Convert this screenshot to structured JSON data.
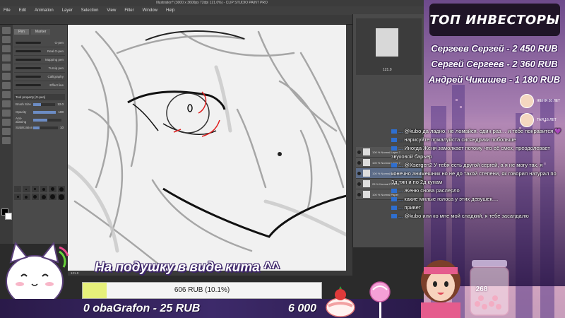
{
  "app": {
    "title": "Illustration* (3000 x 3600px 72dpi 121.0%) - CLIP STUDIO PAINT PRO",
    "menu": [
      "File",
      "Edit",
      "Animation",
      "Layer",
      "Selection",
      "View",
      "Filter",
      "Window",
      "Help"
    ],
    "subtool_tabs": [
      "Pen",
      "Marker"
    ],
    "brushes": [
      "G-pen",
      "Real G-pen",
      "Mapping pen",
      "Turnip pen",
      "Calligraphy",
      "Effect line"
    ],
    "tool_property": {
      "header": "Tool property [G-pen]",
      "rows": [
        {
          "label": "Brush Size",
          "value": "12.0"
        },
        {
          "label": "Opacity",
          "value": "100"
        },
        {
          "label": "Anti-aliasing",
          "value": ""
        },
        {
          "label": "Stabilization",
          "value": "10"
        }
      ],
      "levels": [
        0.35,
        1.0,
        0.5,
        0.25
      ]
    },
    "navigator_zoom": "121.0",
    "canvas_status": "121.0",
    "layers": [
      {
        "name": "100 % Normal Layer 7",
        "selected": false
      },
      {
        "name": "100 % Normal Layer 7",
        "selected": false
      },
      {
        "name": "100 % Normal Layer 6",
        "selected": true
      },
      {
        "name": "25 % Normal Folder 1",
        "selected": false
      },
      {
        "name": "100 % Normal Paper",
        "selected": false
      }
    ]
  },
  "overlay": {
    "top_title": "ТОП ИНВЕСТОРЫ",
    "investors": [
      "Сергеев Сергей - 2 450 RUB",
      "Сергей Сергеев - 2 360 RUB",
      "Андрей Чикишев - 1 180 RUB"
    ],
    "viewers": [
      {
        "name": "ЖЕНЯ 20 ЛЕТ"
      },
      {
        "name": "ТАЯ 16 ЛЕТ"
      }
    ],
    "chat": [
      {
        "user": "...",
        "text": "@kubo да ладно, не ломайся. один раз… и тебе понравится 💜"
      },
      {
        "user": "...",
        "text": "нарисуйте пожалуйста сисяндрики побольше"
      },
      {
        "user": "...",
        "text": "Иногда Женя замолкает потому что её смех, преодолевает звуковой барьер"
      },
      {
        "user": "...",
        "text": "@Xsergen2 У тебя есть другой сергей, а я не могу так, я конечно анимешник но не до такой степени, як говорил натурал по 3д тян и по 2д кунам"
      },
      {
        "user": "...",
        "text": "Женю снова раслерло"
      },
      {
        "user": "...",
        "text": "какие милые голоса у этих девушек...."
      },
      {
        "user": "...",
        "text": "привет"
      },
      {
        "user": "...",
        "text": "@kubo или ко мне мой сладкий, я тебе засандалю"
      }
    ],
    "donation_title": "На подушку в виде кита ^^",
    "goal": {
      "text": "606 RUB (10.1%)",
      "fraction": 0.101
    },
    "last_donation": "0  obaGrafon - 25 RUB",
    "total": "6 000",
    "jar_count": "268"
  },
  "colors": {
    "accent": "#6c8cc4",
    "overlay_purple": "#3d2569",
    "goal_fill": "#e6f07a"
  }
}
